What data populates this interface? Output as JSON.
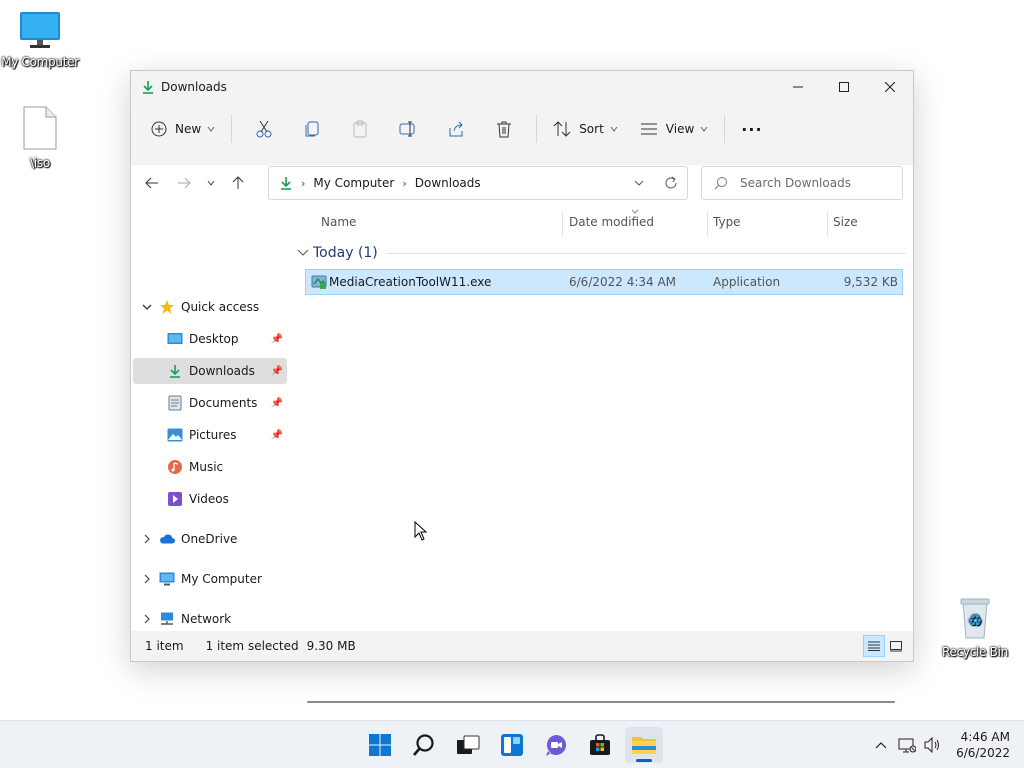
{
  "desktop": {
    "icons": [
      {
        "label": "My Computer"
      },
      {
        "label": "\\iso"
      },
      {
        "label": "Recycle Bin"
      }
    ]
  },
  "window": {
    "title": "Downloads",
    "toolbar": {
      "new_label": "New",
      "sort_label": "Sort",
      "view_label": "View",
      "more_label": "···"
    },
    "address": {
      "crumbs": [
        "My Computer",
        "Downloads"
      ]
    },
    "search": {
      "placeholder": "Search Downloads"
    },
    "nav": {
      "quick_access": "Quick access",
      "items": [
        "Desktop",
        "Downloads",
        "Documents",
        "Pictures",
        "Music",
        "Videos"
      ],
      "onedrive": "OneDrive",
      "my_computer": "My Computer",
      "network": "Network"
    },
    "columns": {
      "name": "Name",
      "date": "Date modified",
      "type": "Type",
      "size": "Size"
    },
    "group": {
      "label": "Today (1)"
    },
    "files": [
      {
        "name": "MediaCreationToolW11.exe",
        "date": "6/6/2022 4:34 AM",
        "type": "Application",
        "size": "9,532 KB"
      }
    ],
    "status": {
      "count": "1 item",
      "selected": "1 item selected",
      "size": "9.30 MB"
    }
  },
  "taskbar": {
    "time": "4:46 AM",
    "date": "6/6/2022"
  },
  "colors": {
    "accent": "#0067c0",
    "selection": "#cce8ff",
    "download_green": "#1a9e5a"
  }
}
